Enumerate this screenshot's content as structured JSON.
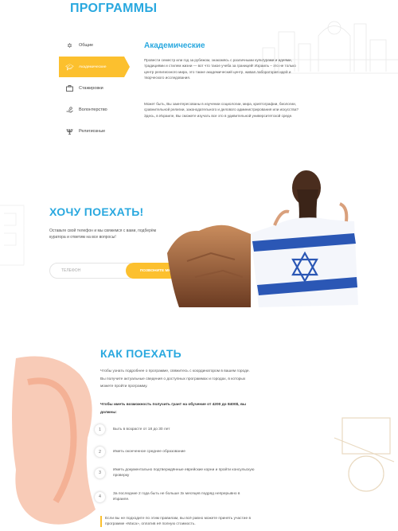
{
  "programs": {
    "title": "ПРОГРАММЫ",
    "menu": [
      {
        "label": "Общие",
        "icon": "star-of-david-icon",
        "active": false
      },
      {
        "label": "Академические",
        "icon": "graduation-cap-icon",
        "active": true
      },
      {
        "label": "Стажировки",
        "icon": "briefcase-icon",
        "active": false
      },
      {
        "label": "Волонтерство",
        "icon": "helping-hand-icon",
        "active": false
      },
      {
        "label": "Религиозные",
        "icon": "menorah-icon",
        "active": false
      }
    ],
    "active_title": "Академические",
    "paragraph1": "Провести семестр или год за рубежом, знакомясь с различными культурами и идеями, традициями и стилем жизни — вот что такое учеба за границей! Израиль – это не только центр религиозного мира, это также академический центр, живая лаборатория идей и творческого исследования.",
    "paragraph2": "Может быть, Вы заинтересованы в изучении социологии, мира, криптографии, биологии, сравнительной религии, законодательного и делового администрирования или искусства? Здесь, в Израиле, Вы сможете изучать все это в удивительной университетской среде."
  },
  "hero": {
    "title": "ХОЧУ ПОЕХАТЬ!",
    "text": "Оставьте свой телефон и мы свяжемся с вами, подберём куратора и ответим на все вопросы!",
    "phone_placeholder": "ТЕЛЕФОН",
    "button_label": "ПОЗВОНИТЕ МНЕ"
  },
  "how": {
    "title": "КАК ПОЕХАТЬ",
    "intro": "Чтобы узнать подробнее о программе, свяжитесь с координатором в вашем городе. Вы получите актуальные сведения о доступных программах и городах, в которых можете пройти программу.",
    "conditions": "Чтобы иметь возможность получить грант на обучение от 4200 до 8400$, вы должны:",
    "steps": [
      {
        "num": "1",
        "text": "Быть в возрасте от 18 до 30 лет"
      },
      {
        "num": "2",
        "text": "Иметь оконченное среднее образование"
      },
      {
        "num": "3",
        "text": "Иметь документально подтверждённые еврейские корни и пройти консульскую проверку"
      },
      {
        "num": "4",
        "text": "За последние 2 года быть не больше 3х месяцев подряд непрерывно в Израиле."
      }
    ],
    "note": "Если вы не подходите по этим правилам, вы всё равно можете принять участие в программе «Маса», оплатив её полную стоимость."
  },
  "colors": {
    "accent_blue": "#29a8df",
    "accent_yellow": "#fcc02e"
  }
}
